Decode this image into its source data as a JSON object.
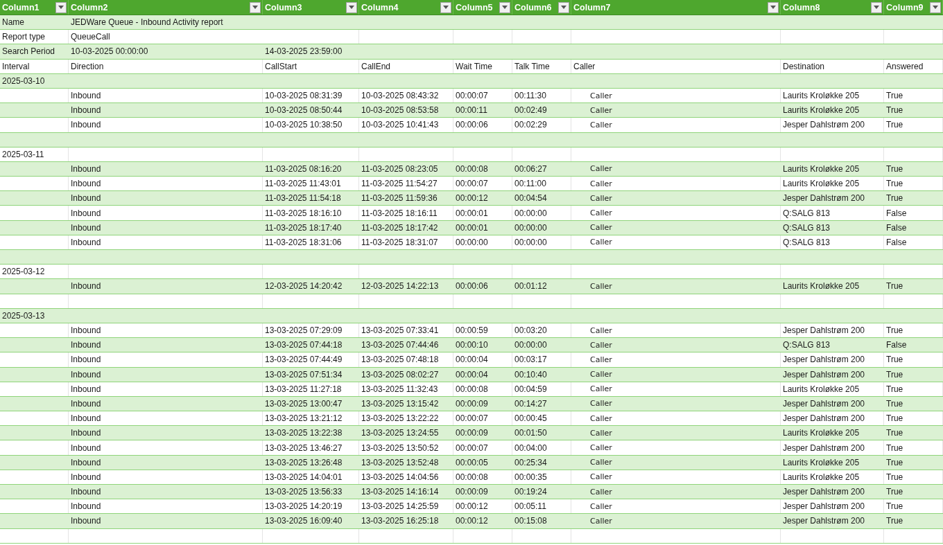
{
  "columns": [
    "Column1",
    "Column2",
    "Column3",
    "Column4",
    "Column5",
    "Column6",
    "Column7",
    "Column8",
    "Column9"
  ],
  "rows": [
    {
      "kind": "meta",
      "label": "Name",
      "value": "JEDWare Queue - Inbound Activity report"
    },
    {
      "kind": "meta",
      "label": "Report type",
      "value": "QueueCall"
    },
    {
      "kind": "meta",
      "label": "Search Period",
      "value": "10-03-2025 00:00:00",
      "value_2": "14-03-2025 23:59:00"
    },
    {
      "kind": "headings",
      "labels": [
        "Interval",
        "Direction",
        "CallStart",
        "CallEnd",
        "Wait Time",
        "Talk Time",
        "Caller",
        "Destination",
        "Answered"
      ]
    },
    {
      "kind": "group",
      "date": "2025-03-10"
    },
    {
      "kind": "call",
      "direction": "Inbound",
      "call_start": "10-03-2025 08:31:39",
      "call_end": "10-03-2025 08:43:32",
      "wait_time": "00:00:07",
      "talk_time": "00:11:30",
      "caller": "Caller",
      "destination": "Laurits Kroløkke 205",
      "answered": "True"
    },
    {
      "kind": "call",
      "direction": "Inbound",
      "call_start": "10-03-2025 08:50:44",
      "call_end": "10-03-2025 08:53:58",
      "wait_time": "00:00:11",
      "talk_time": "00:02:49",
      "caller": "Caller",
      "destination": "Laurits Kroløkke 205",
      "answered": "True"
    },
    {
      "kind": "call",
      "direction": "Inbound",
      "call_start": "10-03-2025 10:38:50",
      "call_end": "10-03-2025 10:41:43",
      "wait_time": "00:00:06",
      "talk_time": "00:02:29",
      "caller": "Caller",
      "destination": "Jesper Dahlstrøm 200",
      "answered": "True"
    },
    {
      "kind": "blank"
    },
    {
      "kind": "group",
      "date": "2025-03-11"
    },
    {
      "kind": "call",
      "direction": "Inbound",
      "call_start": "11-03-2025 08:16:20",
      "call_end": "11-03-2025 08:23:05",
      "wait_time": "00:00:08",
      "talk_time": "00:06:27",
      "caller": "Caller",
      "destination": "Laurits Kroløkke 205",
      "answered": "True"
    },
    {
      "kind": "call",
      "direction": "Inbound",
      "call_start": "11-03-2025 11:43:01",
      "call_end": "11-03-2025 11:54:27",
      "wait_time": "00:00:07",
      "talk_time": "00:11:00",
      "caller": "Caller",
      "destination": "Laurits Kroløkke 205",
      "answered": "True"
    },
    {
      "kind": "call",
      "direction": "Inbound",
      "call_start": "11-03-2025 11:54:18",
      "call_end": "11-03-2025 11:59:36",
      "wait_time": "00:00:12",
      "talk_time": "00:04:54",
      "caller": "Caller",
      "destination": "Jesper Dahlstrøm 200",
      "answered": "True"
    },
    {
      "kind": "call",
      "direction": "Inbound",
      "call_start": "11-03-2025 18:16:10",
      "call_end": "11-03-2025 18:16:11",
      "wait_time": "00:00:01",
      "talk_time": "00:00:00",
      "caller": "Caller",
      "destination": "Q:SALG 813",
      "answered": "False"
    },
    {
      "kind": "call",
      "direction": "Inbound",
      "call_start": "11-03-2025 18:17:40",
      "call_end": "11-03-2025 18:17:42",
      "wait_time": "00:00:01",
      "talk_time": "00:00:00",
      "caller": "Caller",
      "destination": "Q:SALG 813",
      "answered": "False"
    },
    {
      "kind": "call",
      "direction": "Inbound",
      "call_start": "11-03-2025 18:31:06",
      "call_end": "11-03-2025 18:31:07",
      "wait_time": "00:00:00",
      "talk_time": "00:00:00",
      "caller": "Caller",
      "destination": "Q:SALG 813",
      "answered": "False"
    },
    {
      "kind": "blank"
    },
    {
      "kind": "group",
      "date": "2025-03-12"
    },
    {
      "kind": "call",
      "direction": "Inbound",
      "call_start": "12-03-2025 14:20:42",
      "call_end": "12-03-2025 14:22:13",
      "wait_time": "00:00:06",
      "talk_time": "00:01:12",
      "caller": "Caller",
      "destination": "Laurits Kroløkke 205",
      "answered": "True"
    },
    {
      "kind": "blank"
    },
    {
      "kind": "group",
      "date": "2025-03-13"
    },
    {
      "kind": "call",
      "direction": "Inbound",
      "call_start": "13-03-2025 07:29:09",
      "call_end": "13-03-2025 07:33:41",
      "wait_time": "00:00:59",
      "talk_time": "00:03:20",
      "caller": "Caller",
      "destination": "Jesper Dahlstrøm 200",
      "answered": "True"
    },
    {
      "kind": "call",
      "direction": "Inbound",
      "call_start": "13-03-2025 07:44:18",
      "call_end": "13-03-2025 07:44:46",
      "wait_time": "00:00:10",
      "talk_time": "00:00:00",
      "caller": "Caller",
      "destination": "Q:SALG 813",
      "answered": "False"
    },
    {
      "kind": "call",
      "direction": "Inbound",
      "call_start": "13-03-2025 07:44:49",
      "call_end": "13-03-2025 07:48:18",
      "wait_time": "00:00:04",
      "talk_time": "00:03:17",
      "caller": "Caller",
      "destination": "Jesper Dahlstrøm 200",
      "answered": "True"
    },
    {
      "kind": "call",
      "direction": "Inbound",
      "call_start": "13-03-2025 07:51:34",
      "call_end": "13-03-2025 08:02:27",
      "wait_time": "00:00:04",
      "talk_time": "00:10:40",
      "caller": "Caller",
      "destination": "Jesper Dahlstrøm 200",
      "answered": "True"
    },
    {
      "kind": "call",
      "direction": "Inbound",
      "call_start": "13-03-2025 11:27:18",
      "call_end": "13-03-2025 11:32:43",
      "wait_time": "00:00:08",
      "talk_time": "00:04:59",
      "caller": "Caller",
      "destination": "Laurits Kroløkke 205",
      "answered": "True"
    },
    {
      "kind": "call",
      "direction": "Inbound",
      "call_start": "13-03-2025 13:00:47",
      "call_end": "13-03-2025 13:15:42",
      "wait_time": "00:00:09",
      "talk_time": "00:14:27",
      "caller": "Caller",
      "destination": "Jesper Dahlstrøm 200",
      "answered": "True"
    },
    {
      "kind": "call",
      "direction": "Inbound",
      "call_start": "13-03-2025 13:21:12",
      "call_end": "13-03-2025 13:22:22",
      "wait_time": "00:00:07",
      "talk_time": "00:00:45",
      "caller": "Caller",
      "destination": "Jesper Dahlstrøm 200",
      "answered": "True"
    },
    {
      "kind": "call",
      "direction": "Inbound",
      "call_start": "13-03-2025 13:22:38",
      "call_end": "13-03-2025 13:24:55",
      "wait_time": "00:00:09",
      "talk_time": "00:01:50",
      "caller": "Caller",
      "destination": "Laurits Kroløkke 205",
      "answered": "True"
    },
    {
      "kind": "call",
      "direction": "Inbound",
      "call_start": "13-03-2025 13:46:27",
      "call_end": "13-03-2025 13:50:52",
      "wait_time": "00:00:07",
      "talk_time": "00:04:00",
      "caller": "Caller",
      "destination": "Jesper Dahlstrøm 200",
      "answered": "True"
    },
    {
      "kind": "call",
      "direction": "Inbound",
      "call_start": "13-03-2025 13:26:48",
      "call_end": "13-03-2025 13:52:48",
      "wait_time": "00:00:05",
      "talk_time": "00:25:34",
      "caller": "Caller",
      "destination": "Laurits Kroløkke 205",
      "answered": "True"
    },
    {
      "kind": "call",
      "direction": "Inbound",
      "call_start": "13-03-2025 14:04:01",
      "call_end": "13-03-2025 14:04:56",
      "wait_time": "00:00:08",
      "talk_time": "00:00:35",
      "caller": "Caller",
      "destination": "Laurits Kroløkke 205",
      "answered": "True"
    },
    {
      "kind": "call",
      "direction": "Inbound",
      "call_start": "13-03-2025 13:56:33",
      "call_end": "13-03-2025 14:16:14",
      "wait_time": "00:00:09",
      "talk_time": "00:19:24",
      "caller": "Caller",
      "destination": "Jesper Dahlstrøm 200",
      "answered": "True"
    },
    {
      "kind": "call",
      "direction": "Inbound",
      "call_start": "13-03-2025 14:20:19",
      "call_end": "13-03-2025 14:25:59",
      "wait_time": "00:00:12",
      "talk_time": "00:05:11",
      "caller": "Caller",
      "destination": "Jesper Dahlstrøm 200",
      "answered": "True"
    },
    {
      "kind": "call",
      "direction": "Inbound",
      "call_start": "13-03-2025 16:09:40",
      "call_end": "13-03-2025 16:25:18",
      "wait_time": "00:00:12",
      "talk_time": "00:15:08",
      "caller": "Caller",
      "destination": "Jesper Dahlstrøm 200",
      "answered": "True"
    },
    {
      "kind": "blank"
    }
  ]
}
